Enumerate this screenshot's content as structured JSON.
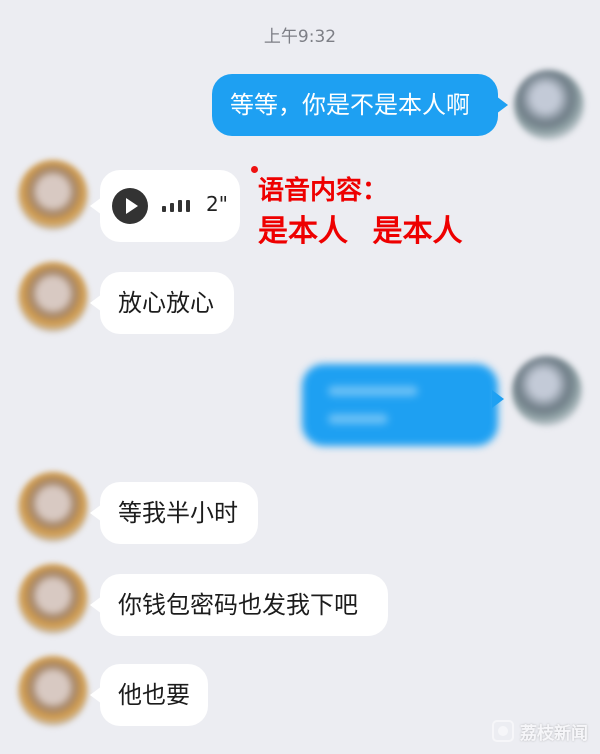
{
  "status": {
    "time": "上午9:32"
  },
  "messages": [
    {
      "sender": "me",
      "text": "等等，你是不是本人啊"
    },
    {
      "sender": "peer",
      "type": "voice",
      "duration": "2\""
    },
    {
      "sender": "peer",
      "text": "放心放心"
    },
    {
      "sender": "me",
      "text": "",
      "blurred": true
    },
    {
      "sender": "peer",
      "text": "等我半小时"
    },
    {
      "sender": "peer",
      "text": "你钱包密码也发我下吧"
    },
    {
      "sender": "peer",
      "text": "他也要"
    }
  ],
  "annotation": {
    "title": "语音内容：",
    "body": "是本人  是本人",
    "color": "#e00000"
  },
  "watermark": {
    "text": "荔枝新闻"
  },
  "colors": {
    "me_bubble": "#1ea0f2",
    "peer_bubble": "#ffffff",
    "background": "#ecedf2"
  },
  "icons": {
    "voice_play": "play-icon",
    "voice_wave": "sound-wave-icon"
  }
}
